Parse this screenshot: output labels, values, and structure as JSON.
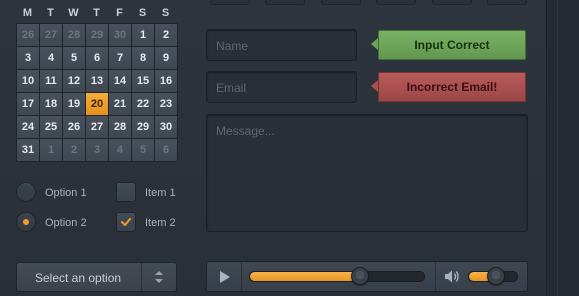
{
  "calendar": {
    "weekdays": [
      "M",
      "T",
      "W",
      "T",
      "F",
      "S",
      "S"
    ],
    "weeks": [
      [
        {
          "d": "26",
          "m": true
        },
        {
          "d": "27",
          "m": true
        },
        {
          "d": "28",
          "m": true
        },
        {
          "d": "29",
          "m": true
        },
        {
          "d": "30",
          "m": true
        },
        {
          "d": "1"
        },
        {
          "d": "2"
        }
      ],
      [
        {
          "d": "3"
        },
        {
          "d": "4"
        },
        {
          "d": "5"
        },
        {
          "d": "6"
        },
        {
          "d": "7"
        },
        {
          "d": "8"
        },
        {
          "d": "9"
        }
      ],
      [
        {
          "d": "10"
        },
        {
          "d": "11"
        },
        {
          "d": "12"
        },
        {
          "d": "13"
        },
        {
          "d": "14"
        },
        {
          "d": "15"
        },
        {
          "d": "16"
        }
      ],
      [
        {
          "d": "17"
        },
        {
          "d": "18"
        },
        {
          "d": "19"
        },
        {
          "d": "20",
          "today": true
        },
        {
          "d": "21"
        },
        {
          "d": "22"
        },
        {
          "d": "23"
        }
      ],
      [
        {
          "d": "24"
        },
        {
          "d": "25"
        },
        {
          "d": "26"
        },
        {
          "d": "27"
        },
        {
          "d": "28"
        },
        {
          "d": "29"
        },
        {
          "d": "30"
        }
      ],
      [
        {
          "d": "31"
        },
        {
          "d": "1",
          "m": true
        },
        {
          "d": "2",
          "m": true
        },
        {
          "d": "3",
          "m": true
        },
        {
          "d": "4",
          "m": true
        },
        {
          "d": "5",
          "m": true
        },
        {
          "d": "6",
          "m": true
        }
      ]
    ]
  },
  "options": {
    "radio1": "Option 1",
    "radio2": "Option 2",
    "check1": "Item 1",
    "check2": "Item 2"
  },
  "select": {
    "label": "Select an option"
  },
  "form": {
    "name_placeholder": "Name",
    "email_placeholder": "Email",
    "message_placeholder": "Message..."
  },
  "validation": {
    "ok_text": "Input Correct",
    "error_text": "Incorrect Email!"
  },
  "player": {
    "progress": 0.63,
    "volume": 0.55
  },
  "colors": {
    "accent": "#f29b2b",
    "success": "#6aa557",
    "error": "#a94f4f",
    "background": "#2b313a"
  }
}
